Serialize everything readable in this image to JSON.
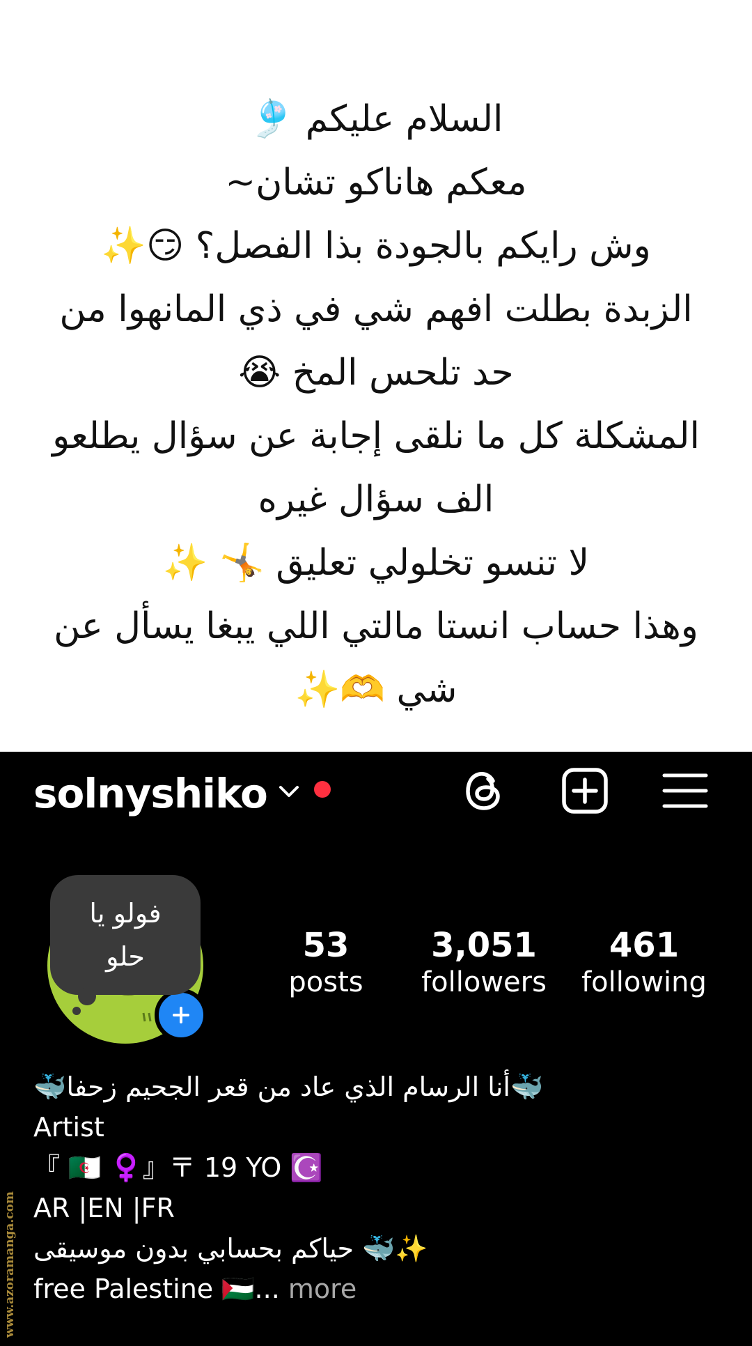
{
  "notice": {
    "lines": [
      "السلام عليكم 🎐",
      "معكم هاناكو تشان~",
      "وش رايكم بالجودة بذا الفصل؟ 😏✨",
      "الزبدة بطلت افهم شي في ذي المانهوا من",
      "حد تلحس المخ 😭",
      "المشكلة كل ما نلقى إجابة عن سؤال يطلعو",
      "الف سؤال غيره",
      "لا تنسو تخلولي تعليق 🤸 ✨",
      "وهذا حساب انستا مالتي اللي يبغا يسأل عن",
      "شي 🫶✨"
    ]
  },
  "profile": {
    "username": "solnyshiko",
    "note": {
      "line1": "فولو يا",
      "line2": "حلو"
    },
    "stats": {
      "posts_value": "53",
      "posts_label": "posts",
      "followers_value": "3,051",
      "followers_label": "followers",
      "following_value": "461",
      "following_label": "following"
    },
    "bio": {
      "line1": "🐳أنا الرسام الذي عاد من قعر الجحيم زحفا🐳",
      "line2": "Artist",
      "line3": "『 🇩🇿 ♀️』〒 19 YO ☪️",
      "line4": "AR |EN |FR",
      "line5": "✨🐳 حياكم بحسابي بدون موسيقى",
      "line6": "free Palestine 🇵🇸...",
      "more": " more"
    }
  },
  "watermark": "www.azoramanga.com",
  "colors": {
    "notification_dot": "#ff3040",
    "add_story_button": "#1f86f5",
    "avatar_background": "#a6ce3b",
    "note_bubble": "#3a3a3a",
    "more_text": "#a8a8a8"
  },
  "icons": {
    "threads": "threads-icon",
    "create": "plus-square-icon",
    "menu": "hamburger-menu-icon",
    "dropdown": "chevron-down-icon"
  }
}
